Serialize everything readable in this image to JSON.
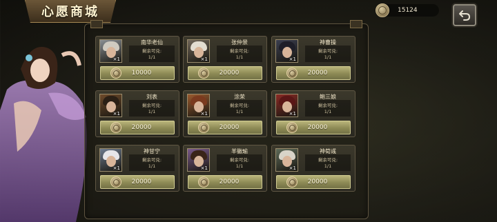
{
  "title": "心愿商城",
  "currency": {
    "amount": "15124",
    "icon": "coin-icon"
  },
  "back_button": {
    "icon": "back-arrow-icon"
  },
  "remain_label": "剩余可兑:",
  "items": [
    {
      "name": "南华老仙",
      "qty": "×1",
      "remain": "1/1",
      "price": "10000",
      "hair": "#cfcac0",
      "bg": "#8a8f94"
    },
    {
      "name": "张仲景",
      "qty": "×1",
      "remain": "1/1",
      "price": "20000",
      "hair": "#e3ddd2",
      "bg": "#6f6558"
    },
    {
      "name": "神曹操",
      "qty": "×1",
      "remain": "1/1",
      "price": "20000",
      "hair": "#1e1e28",
      "bg": "#3a3e4f"
    },
    {
      "name": "刘表",
      "qty": "×1",
      "remain": "1/1",
      "price": "20000",
      "hair": "#2b2015",
      "bg": "#6e4a2a"
    },
    {
      "name": "涂荣",
      "qty": "×1",
      "remain": "1/1",
      "price": "20000",
      "hair": "#7a3a1e",
      "bg": "#9a5a2e"
    },
    {
      "name": "鲍三娘",
      "qty": "×1",
      "remain": "1/1",
      "price": "20000",
      "hair": "#5a1616",
      "bg": "#8a2a24"
    },
    {
      "name": "神甘宁",
      "qty": "×1",
      "remain": "1/1",
      "price": "20000",
      "hair": "#e6e6ea",
      "bg": "#6c7a8e"
    },
    {
      "name": "羊徽瑜",
      "qty": "×1",
      "remain": "1/1",
      "price": "20000",
      "hair": "#3a2418",
      "bg": "#7a5a8a"
    },
    {
      "name": "神荀彧",
      "qty": "×1",
      "remain": "1/1",
      "price": "20000",
      "hair": "#d8d4c8",
      "bg": "#5e6a58"
    }
  ]
}
